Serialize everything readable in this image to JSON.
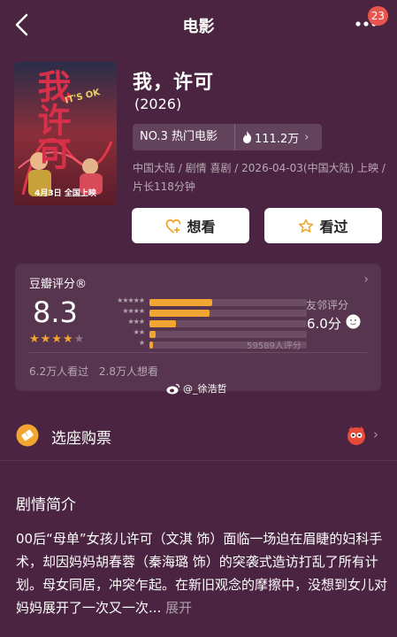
{
  "header": {
    "title": "电影",
    "badge": "23"
  },
  "movie": {
    "title": "我，许可",
    "year": "(2026)",
    "rank": "NO.3 热门电影",
    "heat": "111.2万",
    "meta": "中国大陆 / 剧情 喜剧 / 2026-04-03(中国大陆) 上映 / 片长118分钟",
    "poster": {
      "title": "我许可",
      "subtitle": "IT'S OK",
      "date": "4月3日 全国上映"
    }
  },
  "actions": {
    "want": "想看",
    "seen": "看过"
  },
  "rating": {
    "label": "豆瓣评分®",
    "score": "8.3",
    "stars": 4,
    "distribution": [
      {
        "stars": "★★★★★",
        "percent": 40
      },
      {
        "stars": "★★★★",
        "percent": 38
      },
      {
        "stars": "★★★",
        "percent": 17
      },
      {
        "stars": "★★",
        "percent": 4
      },
      {
        "stars": "★",
        "percent": 2
      }
    ],
    "count": "59589人评分",
    "friend_label": "友邻评分",
    "friend_score": "6.0分",
    "watched": "6.2万人看过",
    "wishlist": "2.8万人想看"
  },
  "watermark": "@_徐浩哲",
  "tickets": {
    "label": "选座购票"
  },
  "synopsis": {
    "title": "剧情简介",
    "text": "00后“母单”女孩儿许可（文淇 饰）面临一场迫在眉睫的妇科手术，却因妈妈胡春蓉（秦海璐 饰）的突袭式造访打乱了所有计划。母女同居，冲突乍起。在新旧观念的摩擦中，没想到女儿对妈妈展开了一次又一次...",
    "expand": "展开"
  },
  "colors": {
    "accent": "#f2a531",
    "background": "#4a2440"
  }
}
